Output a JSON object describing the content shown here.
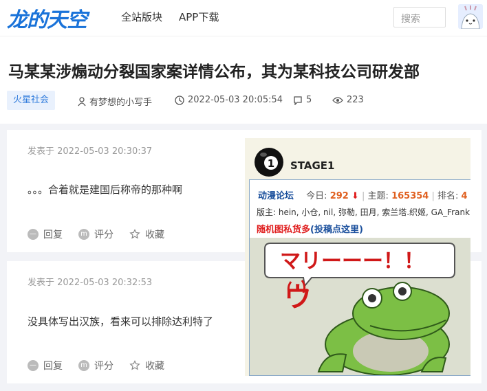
{
  "header": {
    "logo": "龙的天空",
    "nav": [
      "全站版块",
      "APP下载"
    ],
    "search_placeholder": "搜索"
  },
  "article": {
    "title": "马某某涉煽动分裂国家案详情公布，其为某科技公司研发部",
    "tag": "火星社会",
    "author": "有梦想的小写手",
    "datetime": "2022-05-03 20:05:54",
    "comments": "5",
    "views": "223"
  },
  "replies": [
    {
      "time": "发表于 2022-05-03 20:30:37",
      "text": "。。。合着就是建国后称帝的那种啊"
    },
    {
      "time": "发表于 2022-05-03 20:32:53",
      "text": "没具体写出汉族，看来可以排除达利特了"
    }
  ],
  "actions": {
    "reply": "回复",
    "rate": "评分",
    "fav": "收藏"
  },
  "popup": {
    "stage_number": "1",
    "stage_label": "STAGE1",
    "forum_name": "动漫论坛",
    "today_label": "今日:",
    "today_value": "292",
    "topics_label": "主题:",
    "topics_value": "165354",
    "rank_label": "排名:",
    "rank_value": "4",
    "mods": "版主: hein, 小仓, nil, 弥勒, 田月, 索兰塔.织姬, GA_Frank, t",
    "random_label": "随机图私货多",
    "contrib_label": "(投稿点这里)",
    "bubble_text": "マリーーー！！",
    "sfx_text": "ウ"
  },
  "colors": {
    "brand": "#1a73d9",
    "tag_bg": "#e9f1fd",
    "red": "#e02020"
  }
}
